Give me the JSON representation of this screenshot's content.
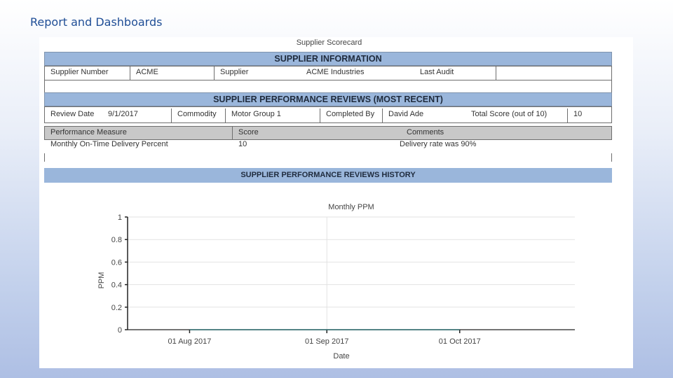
{
  "slide": {
    "title": "Report and Dashboards"
  },
  "scorecard": {
    "title": "Supplier Scorecard",
    "supplier_info": {
      "heading": "SUPPLIER INFORMATION",
      "supplier_number_label": "Supplier Number",
      "supplier_number_value": "ACME",
      "supplier_label": "Supplier",
      "supplier_value": "ACME Industries",
      "last_audit_label": "Last Audit",
      "last_audit_value": ""
    },
    "recent": {
      "heading": "SUPPLIER PERFORMANCE REVIEWS (MOST RECENT)",
      "review_date_label": "Review Date",
      "review_date_value": "9/1/2017",
      "commodity_label": "Commodity",
      "commodity_value": "Motor Group 1",
      "completed_by_label": "Completed By",
      "completed_by_value": "David Ade",
      "total_score_label": "Total Score (out of 10)",
      "total_score_value": "10"
    },
    "measures": {
      "headers": [
        "Performance Measure",
        "Score",
        "Comments"
      ],
      "rows": [
        [
          "Monthly On-Time Delivery Percent",
          "10",
          "Delivery rate was 90%"
        ]
      ]
    },
    "history": {
      "heading": "SUPPLIER PERFORMANCE REVIEWS HISTORY"
    }
  },
  "chart_data": {
    "type": "line",
    "title": "Monthly PPM",
    "xlabel": "Date",
    "ylabel": "PPM",
    "x_ticks": [
      "01 Aug 2017",
      "01 Sep 2017",
      "01 Oct 2017"
    ],
    "y_ticks": [
      "0",
      "0.2",
      "0.4",
      "0.6",
      "0.8",
      "1"
    ],
    "ylim": [
      0,
      1
    ],
    "xlim": [
      "2017-07-18",
      "2017-10-27"
    ],
    "grid": true,
    "series": [
      {
        "x": [
          "2017-08-01",
          "2017-09-01",
          "2017-10-01"
        ],
        "values": [
          0,
          0,
          0
        ],
        "color": "#2e6e70"
      }
    ]
  }
}
